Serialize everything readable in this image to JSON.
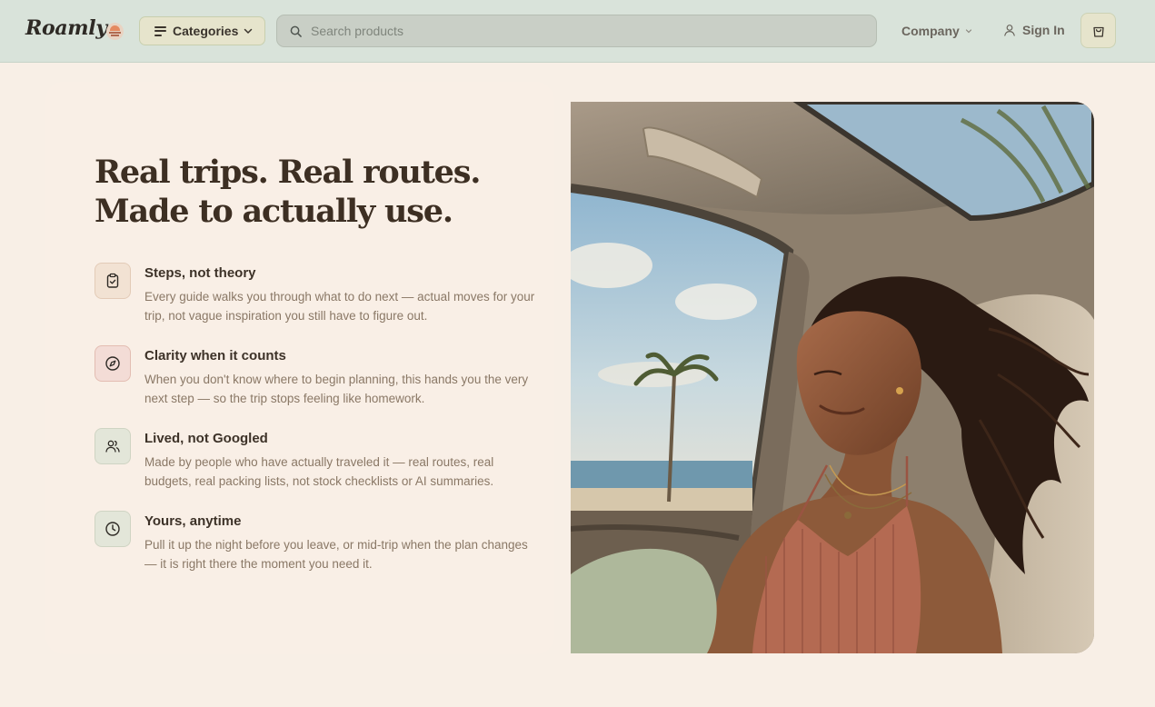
{
  "header": {
    "logo": "Roamly",
    "categories_label": "Categories",
    "search_placeholder": "Search products",
    "company_label": "Company",
    "signin_label": "Sign In"
  },
  "hero": {
    "headline_line1": "Real trips. Real routes.",
    "headline_line2": "Made to actually use.",
    "features": [
      {
        "icon": "clipboard-check-icon",
        "title": "Steps, not theory",
        "description": "Every guide walks you through what to do next — actual moves for your trip, not vague inspiration you still have to figure out."
      },
      {
        "icon": "compass-icon",
        "title": "Clarity when it counts",
        "description": "When you don't know where to begin planning, this hands you the very next step — so the trip stops feeling like homework."
      },
      {
        "icon": "users-icon",
        "title": "Lived, not Googled",
        "description": "Made by people who have actually traveled it — real routes, real budgets, real packing lists, not stock checklists or AI summaries."
      },
      {
        "icon": "clock-icon",
        "title": "Yours, anytime",
        "description": "Pull it up the night before you leave, or mid-trip when the plan changes — it is right there the moment you need it."
      }
    ]
  },
  "colors": {
    "header_bg": "#d9e3da",
    "page_bg": "#f8efe6",
    "headline": "#3d2f23",
    "body_text": "#8a7866"
  }
}
